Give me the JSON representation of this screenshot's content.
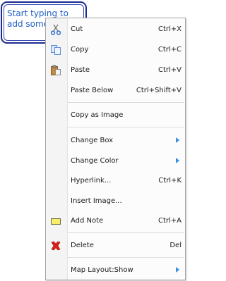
{
  "node": {
    "text": "Start typing to add some text"
  },
  "menu": {
    "items": [
      {
        "label": "Cut",
        "shortcut": "Ctrl+X",
        "icon": "scissors-icon"
      },
      {
        "label": "Copy",
        "shortcut": "Ctrl+C",
        "icon": "copy-icon"
      },
      {
        "label": "Paste",
        "shortcut": "Ctrl+V",
        "icon": "paste-icon"
      },
      {
        "label": "Paste Below",
        "shortcut": "Ctrl+Shift+V"
      },
      {
        "label": "Copy as Image"
      },
      {
        "label": "Change Box",
        "submenu": true
      },
      {
        "label": "Change Color",
        "submenu": true
      },
      {
        "label": "Hyperlink...",
        "shortcut": "Ctrl+K"
      },
      {
        "label": "Insert Image..."
      },
      {
        "label": "Add Note",
        "shortcut": "Ctrl+A",
        "icon": "note-icon"
      },
      {
        "label": "Delete",
        "shortcut": "Del",
        "icon": "delete-icon"
      },
      {
        "label": "Map Layout:Show",
        "submenu": true
      }
    ]
  },
  "colors": {
    "accent": "#3a8ee6",
    "node_border": "#1b2b8f",
    "node_text": "#1f5fc6",
    "delete": "#d9211c"
  }
}
